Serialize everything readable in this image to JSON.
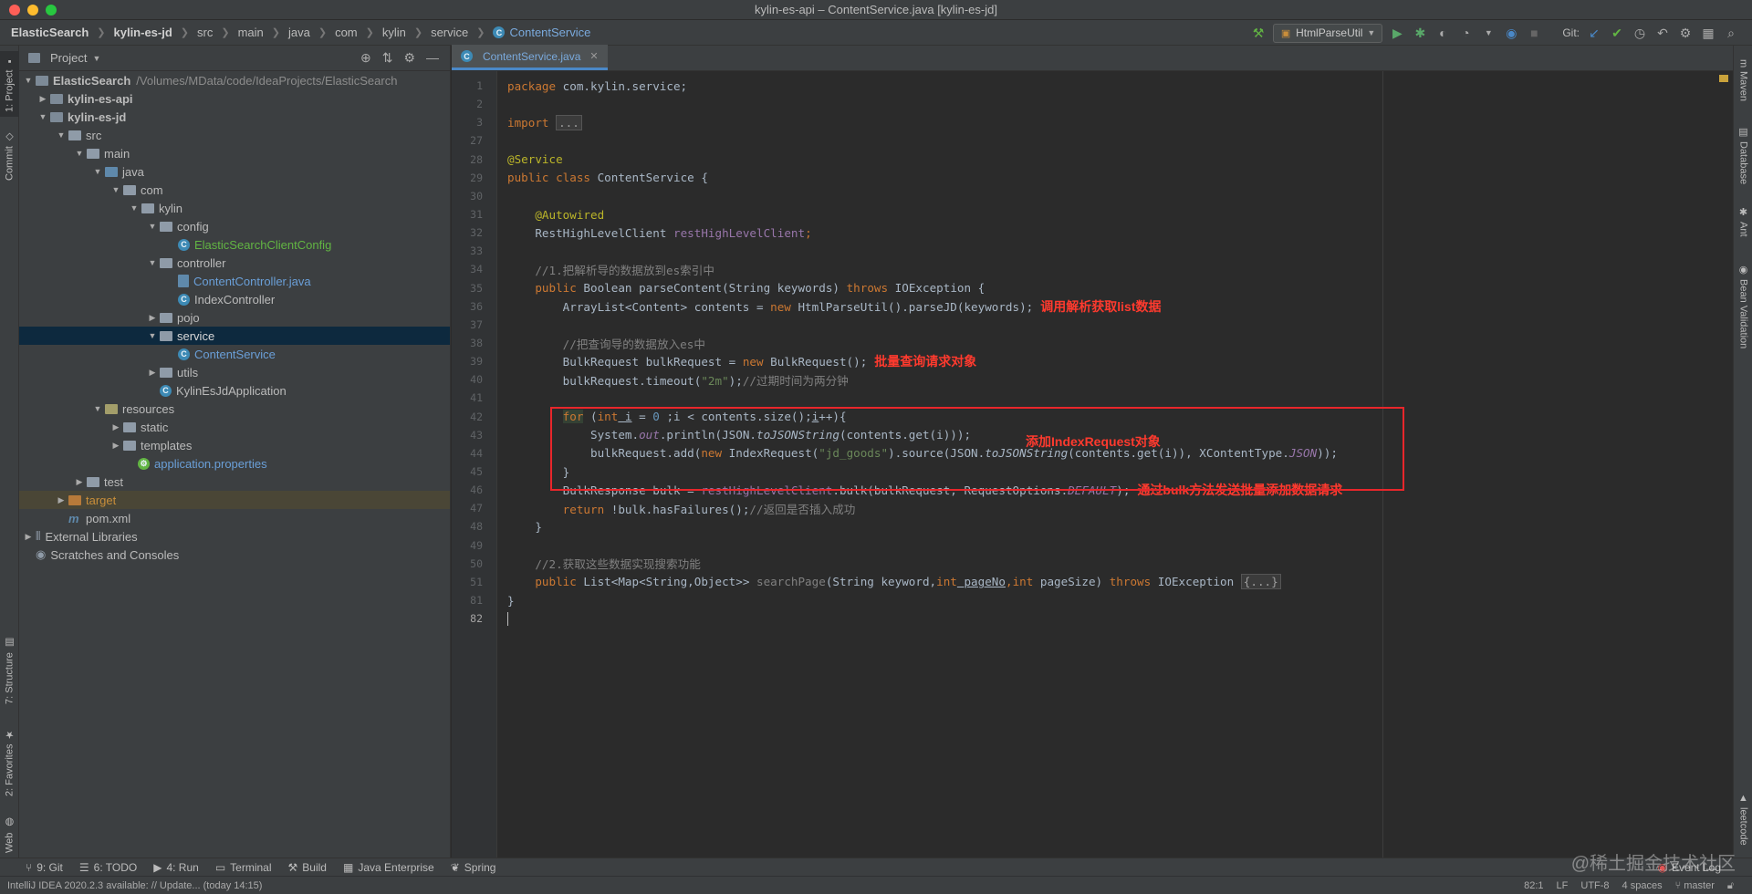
{
  "window": {
    "title": "kylin-es-api – ContentService.java [kylin-es-jd]"
  },
  "breadcrumbs": [
    "ElasticSearch",
    "kylin-es-jd",
    "src",
    "main",
    "java",
    "com",
    "kylin",
    "service",
    "ContentService"
  ],
  "toolbar": {
    "run_config": "HtmlParseUtil",
    "git_label": "Git:"
  },
  "left_strip": {
    "project": "1: Project",
    "commit": "Commit",
    "structure": "7: Structure",
    "favorites": "2: Favorites",
    "web": "Web"
  },
  "right_strip": {
    "maven": "Maven",
    "database": "Database",
    "ant": "Ant",
    "bean": "Bean Validation",
    "leetcode": "leetcode"
  },
  "project_panel": {
    "title": "Project",
    "tree": [
      {
        "label": "ElasticSearch",
        "path": "/Volumes/MData/code/IdeaProjects/ElasticSearch"
      },
      {
        "label": "kylin-es-api"
      },
      {
        "label": "kylin-es-jd"
      },
      {
        "label": "src"
      },
      {
        "label": "main"
      },
      {
        "label": "java"
      },
      {
        "label": "com"
      },
      {
        "label": "kylin"
      },
      {
        "label": "config"
      },
      {
        "label": "ElasticSearchClientConfig"
      },
      {
        "label": "controller"
      },
      {
        "label": "ContentController.java"
      },
      {
        "label": "IndexController"
      },
      {
        "label": "pojo"
      },
      {
        "label": "service"
      },
      {
        "label": "ContentService"
      },
      {
        "label": "utils"
      },
      {
        "label": "KylinEsJdApplication"
      },
      {
        "label": "resources"
      },
      {
        "label": "static"
      },
      {
        "label": "templates"
      },
      {
        "label": "application.properties"
      },
      {
        "label": "test"
      },
      {
        "label": "target"
      },
      {
        "label": "pom.xml"
      },
      {
        "label": "External Libraries"
      },
      {
        "label": "Scratches and Consoles"
      }
    ]
  },
  "editor": {
    "tab": "ContentService.java",
    "line_numbers": [
      "1",
      "2",
      "3",
      "27",
      "28",
      "29",
      "30",
      "31",
      "32",
      "33",
      "34",
      "35",
      "36",
      "37",
      "38",
      "39",
      "40",
      "41",
      "42",
      "43",
      "44",
      "45",
      "46",
      "47",
      "48",
      "49",
      "50",
      "51",
      "81",
      "82"
    ],
    "code": {
      "package": "package",
      "package_name": " com.kylin.service;",
      "import": "import",
      "import_fold": "...",
      "service_ann": "@Service",
      "public_class": "public class",
      "class_name": " ContentService {",
      "autowired": "@Autowired",
      "client_type": "RestHighLevelClient ",
      "client_field": "restHighLevelClient",
      "semi": ";",
      "comment1": "//1.把解析导的数据放到es索引中",
      "public": "public",
      "bool_type": " Boolean ",
      "parse_method": "parseContent",
      "parse_params": "(String keywords) ",
      "throws": "throws",
      "ioexc": " IOException {",
      "arraylist_decl": "ArrayList<Content> contents = ",
      "new": "new",
      "htmlparse_call": " HtmlParseUtil().parseJD(keywords);",
      "comment2": "//把查询导的数据放入es中",
      "bulkreq_decl": "BulkRequest bulkRequest = ",
      "bulkreq_new": " BulkRequest();",
      "timeout_call": "bulkRequest.timeout(",
      "timeout_str": "\"2m\"",
      "timeout_end": ");",
      "comment3": "//过期时间为两分钟",
      "for": "for",
      "for_open": " (",
      "int": "int",
      "for_i": " i",
      "for_init": " = ",
      "zero": "0",
      "for_cond": " ;i < contents.size();",
      "for_incr": "i",
      "for_end": "++){",
      "println_start": "System.",
      "out": "out",
      "println_mid": ".println(JSON.",
      "tojson": "toJSONString",
      "println_args": "(contents.get(i)));",
      "add_start": "bulkRequest.add(",
      "index_req": " IndexRequest(",
      "jd_goods": "\"jd_goods\"",
      "source_call": ").source(JSON.",
      "add_args": "(contents.get(i)), XContentType.",
      "json_const": "JSON",
      "add_end": "));",
      "close_brace": "}",
      "bulkresp_decl": "BulkResponse bulk = ",
      "bulk_call": ".bulk(bulkRequest, RequestOptions.",
      "default_const": "DEFAULT",
      "bulk_end": ");",
      "return": "return",
      "return_expr": " !bulk.hasFailures();",
      "comment4": "//返回是否插入成功",
      "comment5": "//2.获取这些数据实现搜索功能",
      "list_type": " List<Map<String,Object>> ",
      "search_method": "searchPage",
      "search_params1": "(String keyword,",
      "pageno": " pageNo",
      "comma": ",",
      "search_params2": " pageSize) ",
      "ioexc2": " IOException ",
      "search_fold": "{...}"
    },
    "annotations": {
      "parse_note": "调用解析获取list数据",
      "bulk_note": "批量查询请求对象",
      "index_note": "添加IndexRequest对象",
      "send_note": "通过bulk方法发送批量添加数据请求"
    }
  },
  "bottom_tools": [
    "9: Git",
    "6: TODO",
    "4: Run",
    "Terminal",
    "Build",
    "Java Enterprise",
    "Spring"
  ],
  "status_bar": {
    "message": "IntelliJ IDEA 2020.2.3 available: // Update... (today 14:15)",
    "position": "82:1",
    "line_sep": "LF",
    "encoding": "UTF-8",
    "indent": "4 spaces",
    "branch": "master",
    "event_log": "Event Log"
  },
  "watermark": "@稀土掘金技术社区"
}
